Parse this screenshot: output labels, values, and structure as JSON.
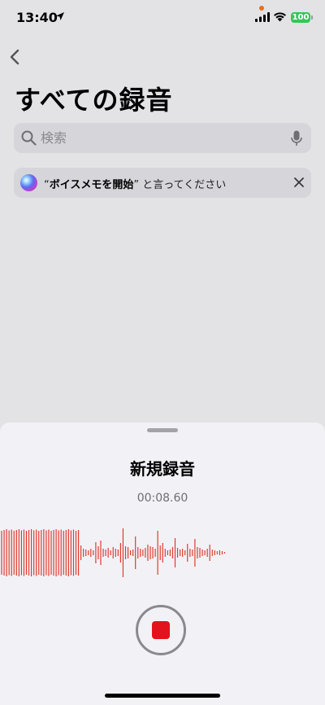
{
  "status_bar": {
    "time": "13:40",
    "battery": "100",
    "battery_color": "#34c759",
    "recording_dot_color": "#e5701c"
  },
  "nav": {
    "back_icon": "chevron-left-icon"
  },
  "page_title": "すべての録音",
  "search": {
    "placeholder": "検索",
    "value": ""
  },
  "siri_banner": {
    "prefix": "“",
    "phrase": "ボイスメモを開始",
    "suffix": "” と言ってください"
  },
  "recording_sheet": {
    "title": "新規録音",
    "elapsed": "00:08.60",
    "waveform_color": "#e03a2f",
    "stop_color": "#e2131c"
  }
}
